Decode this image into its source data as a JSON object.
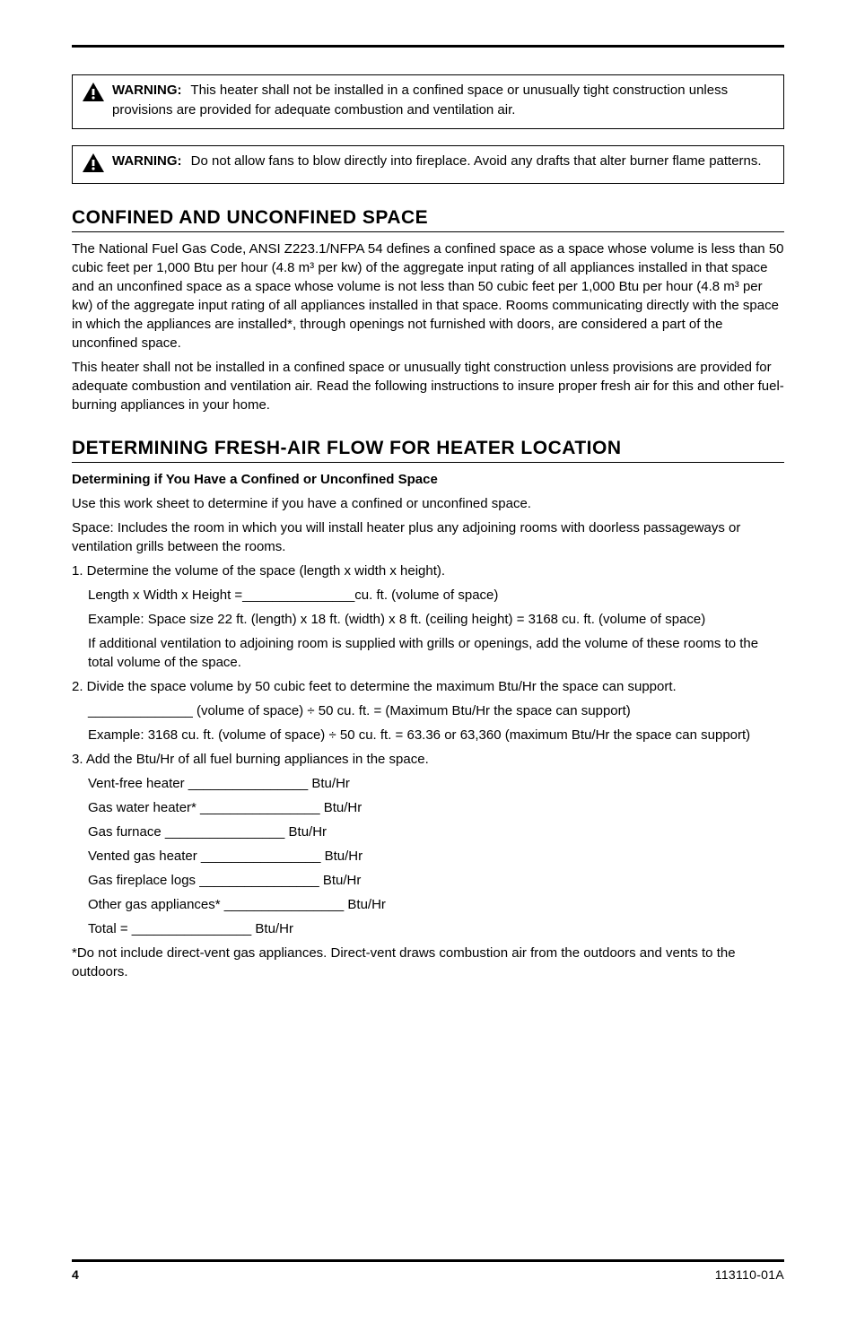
{
  "callouts": [
    {
      "title": "WARNING:",
      "text": "This heater shall not be installed in a confined space or unusually tight construction unless provisions are provided for adequate combustion and ventilation air."
    },
    {
      "title": "WARNING:",
      "text": "Do not allow fans to blow directly into fireplace. Avoid any drafts that alter burner flame patterns."
    }
  ],
  "sections": [
    {
      "heading": "CONFINED AND UNCONFINED SPACE",
      "paragraphs": [
        "The National Fuel Gas Code, ANSI Z223.1/NFPA 54 defines a confined space as a space whose volume is less than 50 cubic feet per 1,000 Btu per hour (4.8 m³ per kw) of the aggregate input rating of all appliances installed in that space and an unconfined space as a space whose volume is not less than 50 cubic feet per 1,000 Btu per hour (4.8 m³ per kw) of the aggregate input rating of all appliances installed in that space. Rooms communicating directly with the space in which the appliances are installed*, through openings not furnished with doors, are considered a part of the unconfined space.",
        "This heater shall not be installed in a confined space or unusually tight construction unless provisions are provided for adequate combustion and ventilation air. Read the following instructions to insure proper fresh air for this and other fuel-burning appliances in your home."
      ]
    },
    {
      "heading": "DETERMINING FRESH-AIR FLOW FOR HEATER LOCATION",
      "paragraphs": [
        "Determining if You Have a Confined or Unconfined Space",
        "Use this work sheet to determine if you have a confined or unconfined space.",
        "Space: Includes the room in which you will install heater plus any adjoining rooms with doorless passageways or ventilation grills between the rooms.",
        "1. Determine the volume of the space (length x width x height).",
        "Length x Width x Height =_______________cu. ft. (volume of space)",
        "Example: Space size 22 ft. (length) x 18 ft. (width) x 8 ft. (ceiling height) = 3168 cu. ft. (volume of space)",
        "If additional ventilation to adjoining room is supplied with grills or openings, add the volume of these rooms to the total volume of the space.",
        "2. Divide the space volume by 50 cubic feet to determine the maximum Btu/Hr the space can support.",
        "______________ (volume of space) ÷ 50 cu. ft. = (Maximum Btu/Hr the space can support)",
        "Example: 3168 cu. ft. (volume of space) ÷ 50 cu. ft. = 63.36 or 63,360 (maximum Btu/Hr the space can support)",
        "3. Add the Btu/Hr of all fuel burning appliances in the space.",
        "Vent-free heater ________________ Btu/Hr",
        "Gas water heater* ________________ Btu/Hr",
        "Gas furnace ________________ Btu/Hr",
        "Vented gas heater ________________ Btu/Hr",
        "Gas fireplace logs ________________ Btu/Hr",
        "Other gas appliances* ________________ Btu/Hr",
        "Total = ________________ Btu/Hr",
        "*Do not include direct-vent gas appliances. Direct-vent draws combustion air from the outdoors and vents to the outdoors."
      ]
    }
  ],
  "footer": {
    "pagenum": "4",
    "docnum": "113110-01A"
  }
}
